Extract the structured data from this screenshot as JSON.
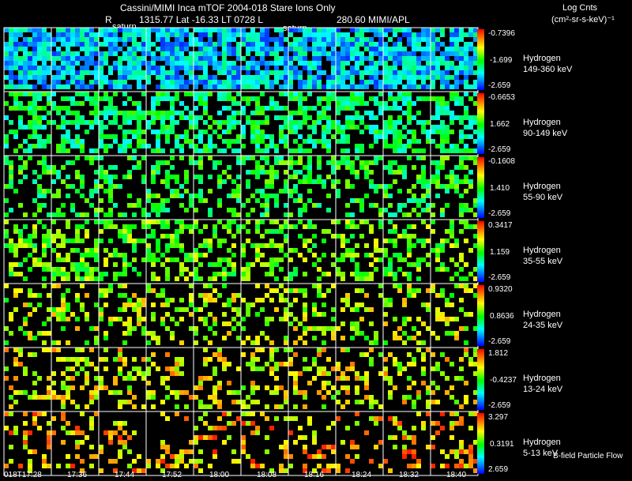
{
  "header": {
    "title": "Cassini/MIMI Inca mTOF  2004-018   Stare   Ions Only",
    "line2_r": "R",
    "line2_pos": "1315.77 Lat -16.33 LT 0728 L",
    "line2_src": "280.60  MIMI/APL",
    "units_line1": "Log Cnts",
    "units_line2": "(cm²-sr-s-keV)⁻¹",
    "saturn_labels": [
      "saturn",
      "saturn"
    ]
  },
  "footer": {
    "flow_label": "B-field Particle Flow"
  },
  "colors": {
    "scale": [
      "#0000ff",
      "#00ffff",
      "#00ff00",
      "#ffff00",
      "#ff0000"
    ],
    "background": "#000000",
    "grid": "#ffffff"
  },
  "chart_data": {
    "type": "heatmap",
    "title": "Cassini/MIMI Inca mTOF  2004-018   Stare   Ions Only",
    "time_labels": [
      "018T17:28",
      "17:36",
      "17:44",
      "17:52",
      "18:00",
      "18:08",
      "18:16",
      "18:24",
      "18:32",
      "18:40"
    ],
    "colorbar_units": "Log Cnts (cm²-sr-s-keV)⁻¹",
    "channels": [
      {
        "species": "Hydrogen",
        "energy": "149-360 keV",
        "max": "-0.7396",
        "mid": "-1.699",
        "min": "-2.659",
        "density": 0.82,
        "bias": 0.22
      },
      {
        "species": "Hydrogen",
        "energy": "90-149 keV",
        "max": "-0.6653",
        "mid": "1.662",
        "min": "-2.659",
        "density": 0.55,
        "bias": 0.4
      },
      {
        "species": "Hydrogen",
        "energy": "55-90 keV",
        "max": "-0.1608",
        "mid": "1.410",
        "min": "-2.659",
        "density": 0.38,
        "bias": 0.48
      },
      {
        "species": "Hydrogen",
        "energy": "35-55 keV",
        "max": "0.3417",
        "mid": "1.159",
        "min": "-2.659",
        "density": 0.42,
        "bias": 0.58
      },
      {
        "species": "Hydrogen",
        "energy": "24-35 keV",
        "max": "0.9320",
        "mid": "0.8636",
        "min": "-2.659",
        "density": 0.3,
        "bias": 0.66
      },
      {
        "species": "Hydrogen",
        "energy": "13-24 keV",
        "max": "1.812",
        "mid": "-0.4237",
        "min": "-2.659",
        "density": 0.3,
        "bias": 0.72
      },
      {
        "species": "Hydrogen",
        "energy": "5-13 keV",
        "max": "3.297",
        "mid": "0.3191",
        "min": "2.659",
        "density": 0.26,
        "bias": 0.8
      }
    ]
  }
}
